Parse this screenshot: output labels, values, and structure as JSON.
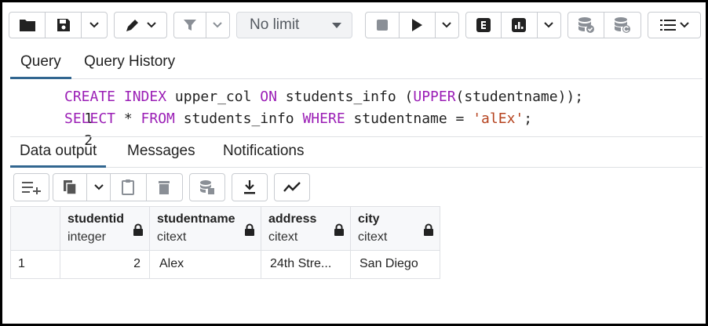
{
  "toolbar": {
    "limit_value": "No limit",
    "icons": [
      "folder-icon",
      "save-icon",
      "chevron-down-icon",
      "edit-pen-icon",
      "filter-icon",
      "stop-icon",
      "play-icon",
      "explain-icon",
      "explain-analyze-icon",
      "commit-icon",
      "rollback-icon",
      "macros-icon"
    ]
  },
  "query_tabs": [
    {
      "label": "Query",
      "active": true
    },
    {
      "label": "Query History",
      "active": false
    }
  ],
  "editor": {
    "lines": [
      {
        "number": "1",
        "tokens": [
          {
            "t": "CREATE",
            "k": "kw"
          },
          {
            "t": " ",
            "k": "plain"
          },
          {
            "t": "INDEX",
            "k": "kw"
          },
          {
            "t": " upper_col ",
            "k": "plain"
          },
          {
            "t": "ON",
            "k": "kw"
          },
          {
            "t": " students_info (",
            "k": "plain"
          },
          {
            "t": "UPPER",
            "k": "kw"
          },
          {
            "t": "(studentname));",
            "k": "plain"
          }
        ]
      },
      {
        "number": "2",
        "tokens": [
          {
            "t": "SELECT",
            "k": "kw"
          },
          {
            "t": " * ",
            "k": "plain"
          },
          {
            "t": "FROM",
            "k": "kw"
          },
          {
            "t": " students_info ",
            "k": "plain"
          },
          {
            "t": "WHERE",
            "k": "kw"
          },
          {
            "t": " studentname = ",
            "k": "plain"
          },
          {
            "t": "'alEx'",
            "k": "str"
          },
          {
            "t": ";",
            "k": "plain"
          }
        ]
      }
    ]
  },
  "output_tabs": [
    {
      "label": "Data output",
      "active": true
    },
    {
      "label": "Messages",
      "active": false
    },
    {
      "label": "Notifications",
      "active": false
    }
  ],
  "grid": {
    "columns": [
      {
        "name": "studentid",
        "type": "integer"
      },
      {
        "name": "studentname",
        "type": "citext"
      },
      {
        "name": "address",
        "type": "citext"
      },
      {
        "name": "city",
        "type": "citext"
      }
    ],
    "rows": [
      {
        "row_number": "1",
        "cells": [
          "2",
          "Alex",
          "24th Stre...",
          "San Diego"
        ]
      }
    ]
  },
  "colors": {
    "keyword": "#9b1fb6",
    "string": "#b5421e",
    "active_tab_underline": "#326690"
  }
}
